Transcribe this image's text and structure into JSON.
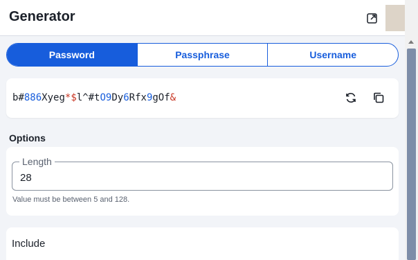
{
  "header": {
    "title": "Generator",
    "popout_icon": "popout-icon",
    "avatar_color": "#ddd4c8"
  },
  "tabs": [
    {
      "label": "Password",
      "active": true
    },
    {
      "label": "Passphrase",
      "active": false
    },
    {
      "label": "Username",
      "active": false
    }
  ],
  "password": {
    "segments": [
      {
        "text": "b",
        "kind": "letter"
      },
      {
        "text": "#",
        "kind": "letter"
      },
      {
        "text": "886",
        "kind": "num"
      },
      {
        "text": "Xyeg",
        "kind": "letter"
      },
      {
        "text": "*$",
        "kind": "sym"
      },
      {
        "text": "l",
        "kind": "letter"
      },
      {
        "text": "^#",
        "kind": "letter"
      },
      {
        "text": "t",
        "kind": "letter"
      },
      {
        "text": "O9",
        "kind": "num"
      },
      {
        "text": "Dy",
        "kind": "letter"
      },
      {
        "text": "6",
        "kind": "num"
      },
      {
        "text": "Rfx",
        "kind": "letter"
      },
      {
        "text": "9",
        "kind": "num"
      },
      {
        "text": "gOf",
        "kind": "letter"
      },
      {
        "text": "&",
        "kind": "sym"
      }
    ],
    "regenerate_icon": "refresh-icon",
    "copy_icon": "copy-icon"
  },
  "options": {
    "heading": "Options",
    "length_label": "Length",
    "length_value": "28",
    "length_hint": "Value must be between 5 and 128."
  },
  "include": {
    "heading": "Include"
  },
  "colors": {
    "accent": "#175ddc",
    "symbol": "#c83522",
    "background": "#f2f4f8"
  }
}
